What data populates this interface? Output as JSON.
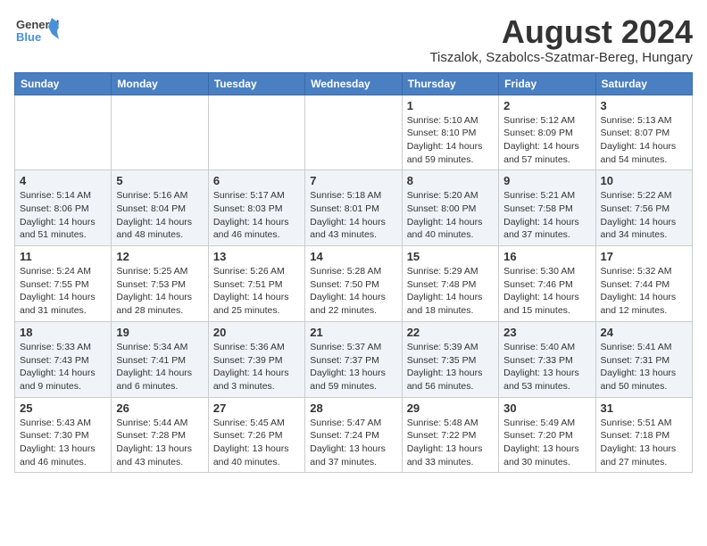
{
  "header": {
    "logo_line1": "General",
    "logo_line2": "Blue",
    "main_title": "August 2024",
    "sub_title": "Tiszalok, Szabolcs-Szatmar-Bereg, Hungary"
  },
  "weekdays": [
    "Sunday",
    "Monday",
    "Tuesday",
    "Wednesday",
    "Thursday",
    "Friday",
    "Saturday"
  ],
  "weeks": [
    [
      {
        "day": "",
        "info": ""
      },
      {
        "day": "",
        "info": ""
      },
      {
        "day": "",
        "info": ""
      },
      {
        "day": "",
        "info": ""
      },
      {
        "day": "1",
        "info": "Sunrise: 5:10 AM\nSunset: 8:10 PM\nDaylight: 14 hours\nand 59 minutes."
      },
      {
        "day": "2",
        "info": "Sunrise: 5:12 AM\nSunset: 8:09 PM\nDaylight: 14 hours\nand 57 minutes."
      },
      {
        "day": "3",
        "info": "Sunrise: 5:13 AM\nSunset: 8:07 PM\nDaylight: 14 hours\nand 54 minutes."
      }
    ],
    [
      {
        "day": "4",
        "info": "Sunrise: 5:14 AM\nSunset: 8:06 PM\nDaylight: 14 hours\nand 51 minutes."
      },
      {
        "day": "5",
        "info": "Sunrise: 5:16 AM\nSunset: 8:04 PM\nDaylight: 14 hours\nand 48 minutes."
      },
      {
        "day": "6",
        "info": "Sunrise: 5:17 AM\nSunset: 8:03 PM\nDaylight: 14 hours\nand 46 minutes."
      },
      {
        "day": "7",
        "info": "Sunrise: 5:18 AM\nSunset: 8:01 PM\nDaylight: 14 hours\nand 43 minutes."
      },
      {
        "day": "8",
        "info": "Sunrise: 5:20 AM\nSunset: 8:00 PM\nDaylight: 14 hours\nand 40 minutes."
      },
      {
        "day": "9",
        "info": "Sunrise: 5:21 AM\nSunset: 7:58 PM\nDaylight: 14 hours\nand 37 minutes."
      },
      {
        "day": "10",
        "info": "Sunrise: 5:22 AM\nSunset: 7:56 PM\nDaylight: 14 hours\nand 34 minutes."
      }
    ],
    [
      {
        "day": "11",
        "info": "Sunrise: 5:24 AM\nSunset: 7:55 PM\nDaylight: 14 hours\nand 31 minutes."
      },
      {
        "day": "12",
        "info": "Sunrise: 5:25 AM\nSunset: 7:53 PM\nDaylight: 14 hours\nand 28 minutes."
      },
      {
        "day": "13",
        "info": "Sunrise: 5:26 AM\nSunset: 7:51 PM\nDaylight: 14 hours\nand 25 minutes."
      },
      {
        "day": "14",
        "info": "Sunrise: 5:28 AM\nSunset: 7:50 PM\nDaylight: 14 hours\nand 22 minutes."
      },
      {
        "day": "15",
        "info": "Sunrise: 5:29 AM\nSunset: 7:48 PM\nDaylight: 14 hours\nand 18 minutes."
      },
      {
        "day": "16",
        "info": "Sunrise: 5:30 AM\nSunset: 7:46 PM\nDaylight: 14 hours\nand 15 minutes."
      },
      {
        "day": "17",
        "info": "Sunrise: 5:32 AM\nSunset: 7:44 PM\nDaylight: 14 hours\nand 12 minutes."
      }
    ],
    [
      {
        "day": "18",
        "info": "Sunrise: 5:33 AM\nSunset: 7:43 PM\nDaylight: 14 hours\nand 9 minutes."
      },
      {
        "day": "19",
        "info": "Sunrise: 5:34 AM\nSunset: 7:41 PM\nDaylight: 14 hours\nand 6 minutes."
      },
      {
        "day": "20",
        "info": "Sunrise: 5:36 AM\nSunset: 7:39 PM\nDaylight: 14 hours\nand 3 minutes."
      },
      {
        "day": "21",
        "info": "Sunrise: 5:37 AM\nSunset: 7:37 PM\nDaylight: 13 hours\nand 59 minutes."
      },
      {
        "day": "22",
        "info": "Sunrise: 5:39 AM\nSunset: 7:35 PM\nDaylight: 13 hours\nand 56 minutes."
      },
      {
        "day": "23",
        "info": "Sunrise: 5:40 AM\nSunset: 7:33 PM\nDaylight: 13 hours\nand 53 minutes."
      },
      {
        "day": "24",
        "info": "Sunrise: 5:41 AM\nSunset: 7:31 PM\nDaylight: 13 hours\nand 50 minutes."
      }
    ],
    [
      {
        "day": "25",
        "info": "Sunrise: 5:43 AM\nSunset: 7:30 PM\nDaylight: 13 hours\nand 46 minutes."
      },
      {
        "day": "26",
        "info": "Sunrise: 5:44 AM\nSunset: 7:28 PM\nDaylight: 13 hours\nand 43 minutes."
      },
      {
        "day": "27",
        "info": "Sunrise: 5:45 AM\nSunset: 7:26 PM\nDaylight: 13 hours\nand 40 minutes."
      },
      {
        "day": "28",
        "info": "Sunrise: 5:47 AM\nSunset: 7:24 PM\nDaylight: 13 hours\nand 37 minutes."
      },
      {
        "day": "29",
        "info": "Sunrise: 5:48 AM\nSunset: 7:22 PM\nDaylight: 13 hours\nand 33 minutes."
      },
      {
        "day": "30",
        "info": "Sunrise: 5:49 AM\nSunset: 7:20 PM\nDaylight: 13 hours\nand 30 minutes."
      },
      {
        "day": "31",
        "info": "Sunrise: 5:51 AM\nSunset: 7:18 PM\nDaylight: 13 hours\nand 27 minutes."
      }
    ]
  ]
}
